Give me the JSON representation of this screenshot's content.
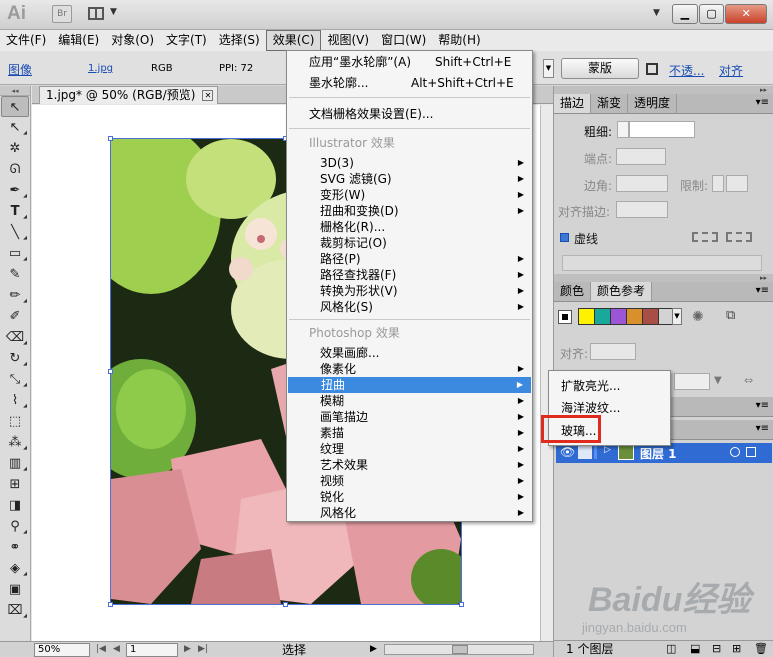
{
  "app": {
    "logo": "Ai",
    "bridge_label": "Br"
  },
  "menubar": [
    "文件(F)",
    "编辑(E)",
    "对象(O)",
    "文字(T)",
    "选择(S)",
    "效果(C)",
    "视图(V)",
    "窗口(W)",
    "帮助(H)"
  ],
  "control": {
    "type_label": "图像",
    "filename": "1.jpg",
    "mode": "RGB",
    "ppi": "PPI: 72",
    "mask_button": "蒙版",
    "opacity_link": "不透...",
    "align_link": "对齐"
  },
  "document": {
    "tab_title": "1.jpg* @ 50% (RGB/预览)"
  },
  "effect_menu": {
    "apply_last": "应用“墨水轮廓”(A)",
    "apply_last_shortcut": "Shift+Ctrl+E",
    "last_effect": "墨水轮廓...",
    "last_effect_shortcut": "Alt+Shift+Ctrl+E",
    "raster_settings": "文档栅格效果设置(E)...",
    "illustrator_header": "Illustrator 效果",
    "illustrator_items": [
      "3D(3)",
      "SVG 滤镜(G)",
      "变形(W)",
      "扭曲和变换(D)",
      "栅格化(R)...",
      "裁剪标记(O)",
      "路径(P)",
      "路径查找器(F)",
      "转换为形状(V)",
      "风格化(S)"
    ],
    "photoshop_header": "Photoshop 效果",
    "photoshop_items": [
      "效果画廊...",
      "像素化",
      "扭曲",
      "模糊",
      "画笔描边",
      "素描",
      "纹理",
      "艺术效果",
      "视频",
      "锐化",
      "风格化"
    ]
  },
  "distort_submenu": [
    "扩散亮光...",
    "海洋波纹...",
    "玻璃..."
  ],
  "panels": {
    "stroke_tabs": [
      "描边",
      "渐变",
      "透明度"
    ],
    "weight_label": "粗细:",
    "cap_label": "端点:",
    "corner_label": "边角:",
    "limit_label": "限制:",
    "align_stroke_label": "对齐描边:",
    "dashed_label": "虚线",
    "color_tabs": [
      "颜色",
      "颜色参考"
    ],
    "align_label": "对齐:",
    "layer_name": "图层 1",
    "layer_count": "1 个图层",
    "harmony_colors": [
      "#fff200",
      "#1aa89a",
      "#9b55d6",
      "#d8902c",
      "#a94e44"
    ]
  },
  "status": {
    "zoom": "50%",
    "page": "1",
    "status_text": "选择"
  },
  "watermark": {
    "title": "Baidu经验",
    "url": "jingyan.baidu.com"
  }
}
